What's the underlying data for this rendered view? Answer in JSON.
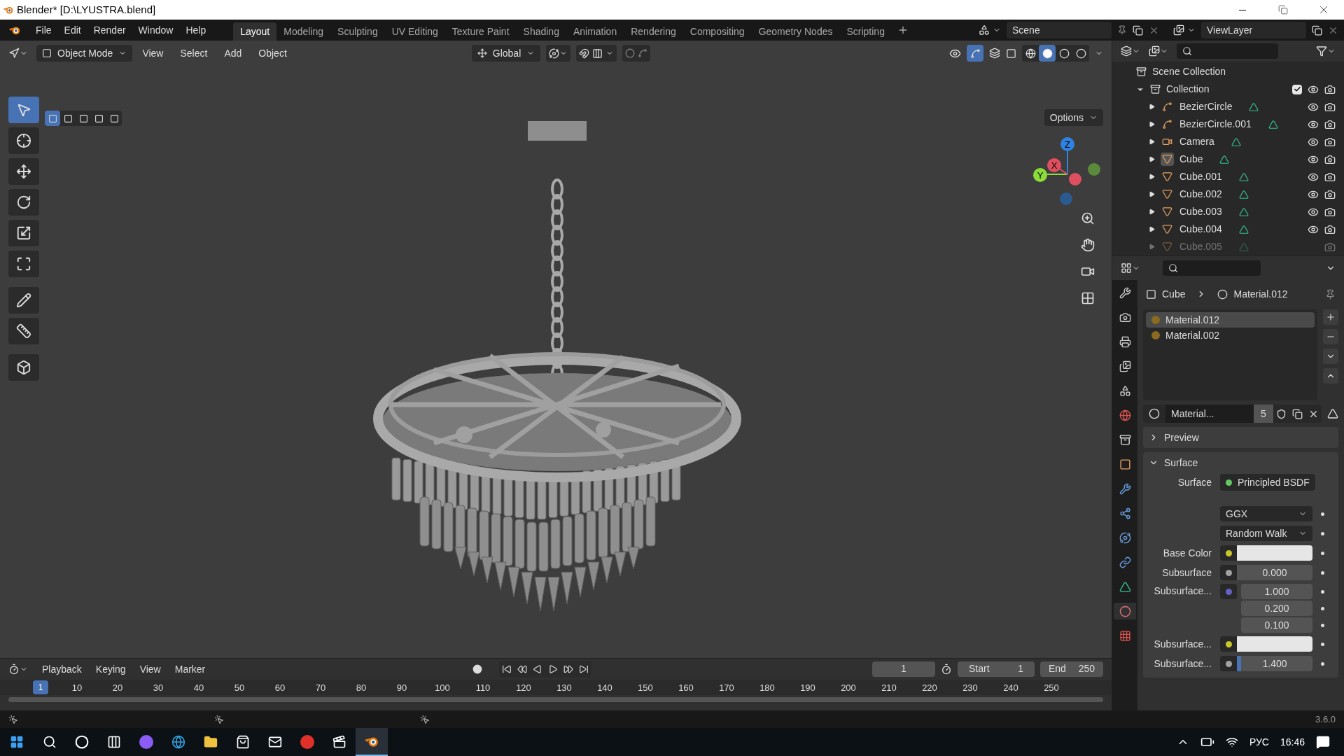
{
  "window": {
    "title": "Blender* [D:\\LYUSTRA.blend]"
  },
  "menu": [
    "File",
    "Edit",
    "Render",
    "Window",
    "Help"
  ],
  "workspaces": [
    {
      "label": "Layout",
      "selected": true
    },
    {
      "label": "Modeling",
      "selected": false
    },
    {
      "label": "Sculpting",
      "selected": false
    },
    {
      "label": "UV Editing",
      "selected": false
    },
    {
      "label": "Texture Paint",
      "selected": false
    },
    {
      "label": "Shading",
      "selected": false
    },
    {
      "label": "Animation",
      "selected": false
    },
    {
      "label": "Rendering",
      "selected": false
    },
    {
      "label": "Compositing",
      "selected": false
    },
    {
      "label": "Geometry Nodes",
      "selected": false
    },
    {
      "label": "Scripting",
      "selected": false
    }
  ],
  "scene": "Scene",
  "view_layer": "ViewLayer",
  "viewport": {
    "mode": "Object Mode",
    "menus": [
      "View",
      "Select",
      "Add",
      "Object"
    ],
    "orientation": "Global",
    "options": "Options",
    "select_modes": [
      {
        "selected": true
      },
      {
        "selected": false
      },
      {
        "selected": false
      },
      {
        "selected": false
      },
      {
        "selected": false
      }
    ],
    "shading": [
      {
        "kind": "wireframe",
        "selected": false
      },
      {
        "kind": "solid",
        "selected": true
      },
      {
        "kind": "material",
        "selected": false
      },
      {
        "kind": "rendered",
        "selected": false
      }
    ],
    "tools": [
      {
        "kind": "select",
        "selected": true
      },
      {
        "kind": "cursor",
        "selected": false
      },
      {
        "kind": "move",
        "selected": false
      },
      {
        "kind": "rotate",
        "selected": false
      },
      {
        "kind": "scale",
        "selected": false
      },
      {
        "kind": "transform",
        "selected": false
      },
      {
        "kind": "annotate",
        "selected": false
      },
      {
        "kind": "measure",
        "selected": false
      },
      {
        "kind": "add_cube",
        "selected": false
      }
    ],
    "gizmo_axes": [
      "Z",
      "X",
      "Y"
    ]
  },
  "outliner": {
    "root": "Scene Collection",
    "collection": {
      "label": "Collection",
      "expanded": true,
      "checked": true,
      "children": [
        {
          "label": "BezierCircle",
          "kind": "curve",
          "active": false
        },
        {
          "label": "BezierCircle.001",
          "kind": "curve",
          "active": false
        },
        {
          "label": "Camera",
          "kind": "camera",
          "active": false
        },
        {
          "label": "Cube",
          "kind": "mesh",
          "active": true
        },
        {
          "label": "Cube.001",
          "kind": "mesh",
          "active": false
        },
        {
          "label": "Cube.002",
          "kind": "mesh",
          "active": false
        },
        {
          "label": "Cube.003",
          "kind": "mesh",
          "active": false
        },
        {
          "label": "Cube.004",
          "kind": "mesh",
          "active": false
        },
        {
          "label": "Cube.005",
          "kind": "mesh",
          "active": false
        }
      ]
    }
  },
  "properties": {
    "tabs": [
      {
        "kind": "tool",
        "selected": false
      },
      {
        "kind": "render",
        "selected": false
      },
      {
        "kind": "output",
        "selected": false
      },
      {
        "kind": "view_layer",
        "selected": false
      },
      {
        "kind": "scene",
        "selected": false
      },
      {
        "kind": "world",
        "selected": false
      },
      {
        "kind": "collection",
        "selected": false
      },
      {
        "kind": "object",
        "selected": false
      },
      {
        "kind": "modifiers",
        "selected": false
      },
      {
        "kind": "particles",
        "selected": false
      },
      {
        "kind": "physics",
        "selected": false
      },
      {
        "kind": "constraints",
        "selected": false
      },
      {
        "kind": "data",
        "selected": false
      },
      {
        "kind": "material",
        "selected": true
      },
      {
        "kind": "texture",
        "selected": false
      }
    ],
    "breadcrumb": {
      "object": "Cube",
      "material": "Material.012"
    },
    "slots": [
      {
        "label": "Material.012",
        "selected": true
      },
      {
        "label": "Material.002",
        "selected": false
      }
    ],
    "material_name": "Material...",
    "users": "5",
    "panels": [
      {
        "label": "Preview",
        "expanded": false
      },
      {
        "label": "Surface",
        "expanded": true
      }
    ],
    "fields": [
      {
        "kind": "link",
        "label": "Surface",
        "value": "Principled BSDF",
        "color": "#63c763"
      },
      {
        "kind": "dropdown",
        "value": "GGX"
      },
      {
        "kind": "dropdown",
        "value": "Random Walk"
      },
      {
        "kind": "swatch",
        "label": "Base Color",
        "color": "#c7c729"
      },
      {
        "kind": "number",
        "label": "Subsurface",
        "color": "#a1a1a1",
        "values": [
          "0.000"
        ]
      },
      {
        "kind": "vector",
        "label": "Subsurface...",
        "color": "#6363c7",
        "values": [
          "1.000",
          "0.200",
          "0.100"
        ]
      },
      {
        "kind": "swatch",
        "label": "Subsurface...",
        "color": "#c7c729"
      },
      {
        "kind": "number",
        "label": "Subsurface...",
        "color": "#a1a1a1",
        "values": [
          "1.400"
        ],
        "level": 0.06
      }
    ]
  },
  "timeline": {
    "menus": [
      "Playback",
      "Keying",
      "View",
      "Marker"
    ],
    "current_frame": "1",
    "start_label": "Start",
    "start": "1",
    "end_label": "End",
    "end": "250",
    "ticks": [
      "1",
      "10",
      "20",
      "30",
      "40",
      "50",
      "60",
      "70",
      "80",
      "90",
      "100",
      "110",
      "120",
      "130",
      "140",
      "150",
      "160",
      "170",
      "180",
      "190",
      "200",
      "210",
      "220",
      "230",
      "240",
      "250"
    ]
  },
  "version": "3.6.0",
  "taskbar": {
    "language": "РУС",
    "time": "16:46"
  }
}
